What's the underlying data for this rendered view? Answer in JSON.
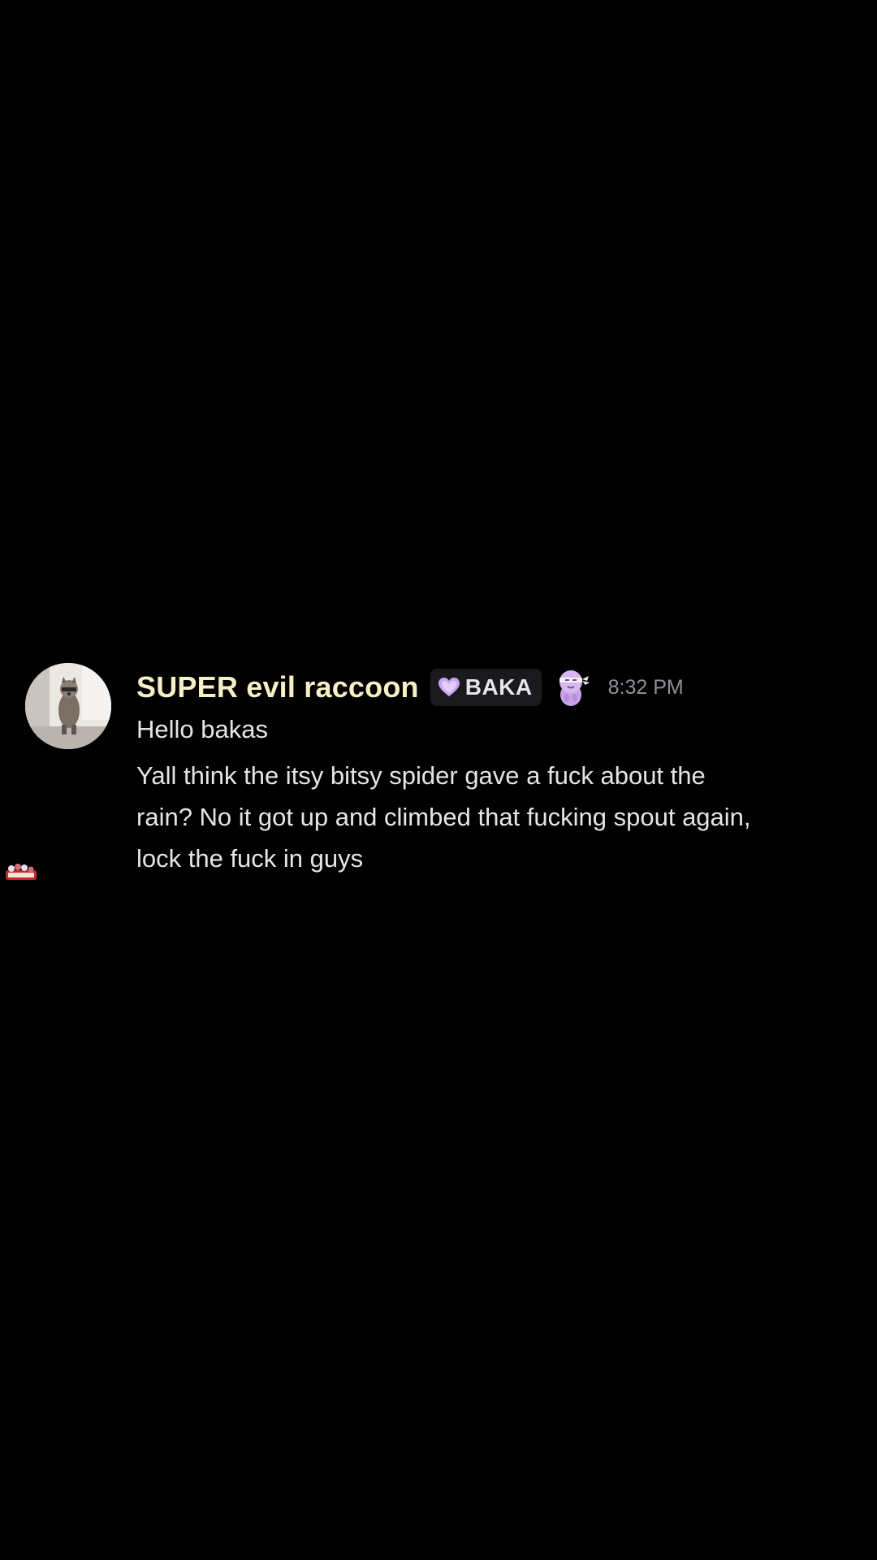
{
  "message": {
    "username": "SUPER evil raccoon",
    "tag": "BAKA",
    "timestamp": "8:32 PM",
    "line1": "Hello bakas",
    "body_lines": [
      "Yall think the itsy bitsy spider gave a fuck about the",
      "rain? No it got up and climbed that fucking spout again,",
      "lock the fuck in guys"
    ]
  },
  "colors": {
    "background": "#000000",
    "username": "#f7efc5",
    "text": "#e4e5e8",
    "timestamp": "#8e9199",
    "tag_bg": "#1a1a1d",
    "heart": "#c9a6f2"
  },
  "icons": {
    "avatar": "raccoon-avatar",
    "tag_icon": "purple-heart-icon",
    "badge_emoji": "ninja-blob-emoji",
    "side_sticker": "sticker-icon"
  }
}
